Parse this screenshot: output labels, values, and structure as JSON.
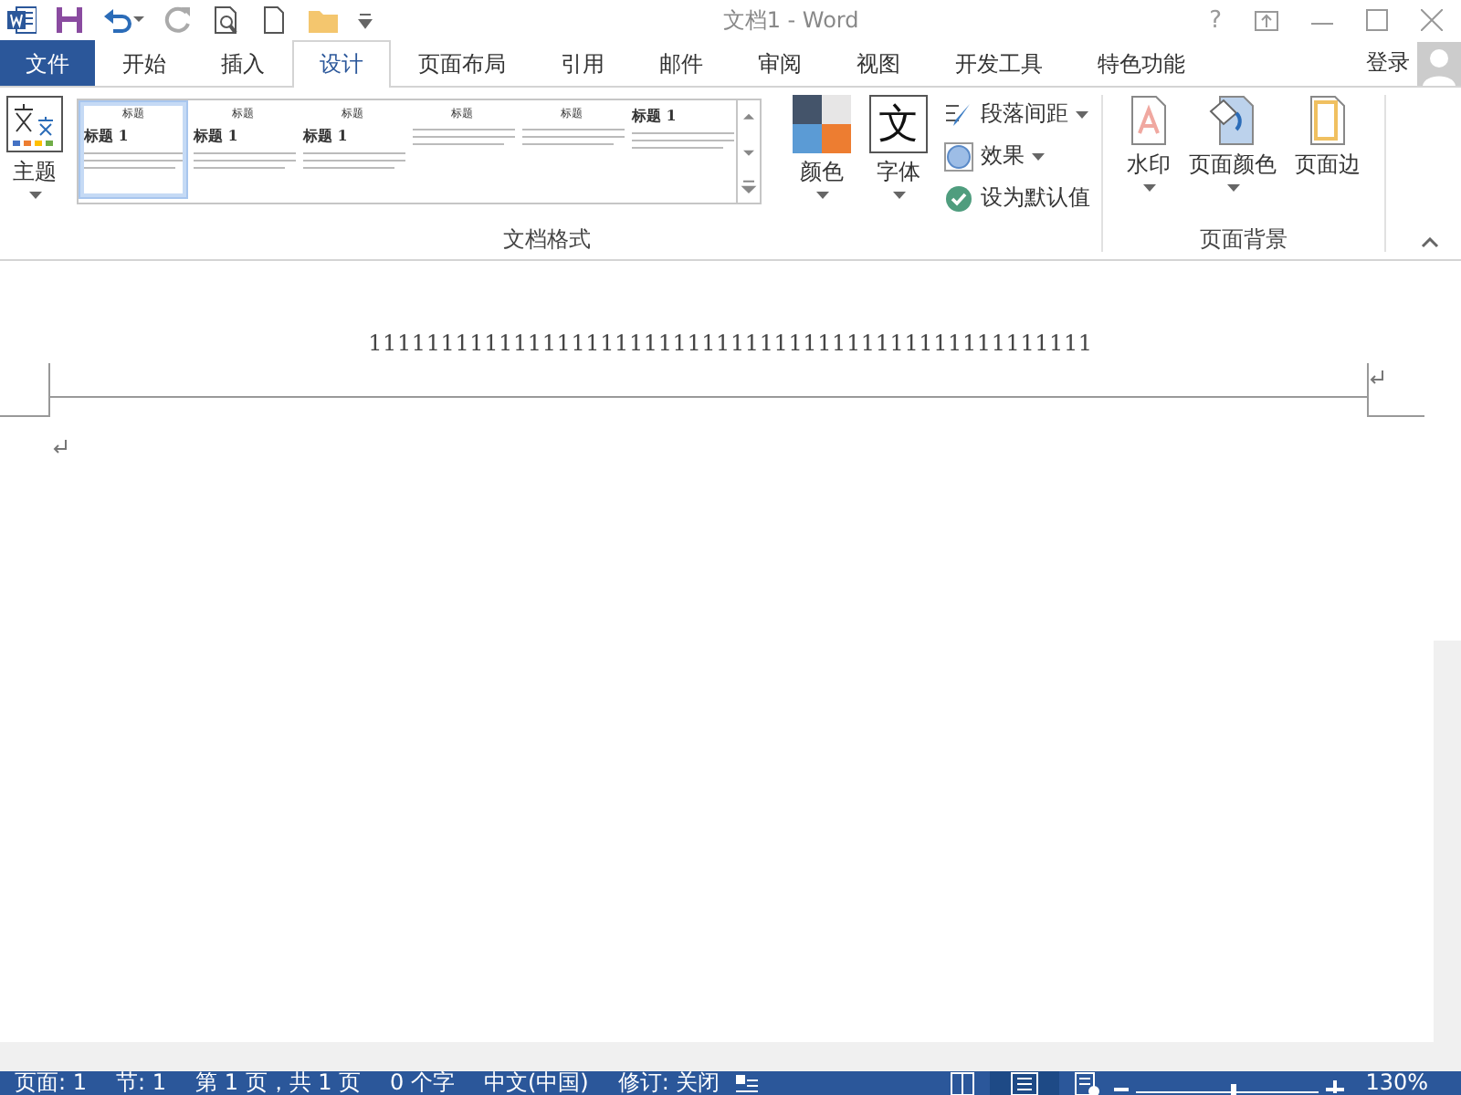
{
  "window": {
    "title": "文档1 - Word",
    "help": "?"
  },
  "tabs": [
    {
      "label": "文件",
      "kind": "file",
      "selected": false
    },
    {
      "label": "开始",
      "kind": "tab",
      "selected": false
    },
    {
      "label": "插入",
      "kind": "tab",
      "selected": false
    },
    {
      "label": "设计",
      "kind": "tab",
      "selected": true
    },
    {
      "label": "页面布局",
      "kind": "tab",
      "selected": false
    },
    {
      "label": "引用",
      "kind": "tab",
      "selected": false
    },
    {
      "label": "邮件",
      "kind": "tab",
      "selected": false
    },
    {
      "label": "审阅",
      "kind": "tab",
      "selected": false
    },
    {
      "label": "视图",
      "kind": "tab",
      "selected": false
    },
    {
      "label": "开发工具",
      "kind": "tab",
      "selected": false
    },
    {
      "label": "特色功能",
      "kind": "tab",
      "selected": false
    }
  ],
  "account": {
    "label": "登录"
  },
  "ribbon": {
    "theme_button": "主题",
    "gallery": [
      {
        "title": "标题",
        "heading": "标题 1",
        "selected": true
      },
      {
        "title": "标题",
        "heading": "标题 1",
        "selected": false
      },
      {
        "title": "标题",
        "heading": "标题 1",
        "selected": false
      },
      {
        "title": "标题",
        "selected": false
      },
      {
        "title": "标题",
        "selected": false
      },
      {
        "heading": "标题 1",
        "selected": false
      }
    ],
    "colors_button": "颜色",
    "fonts_icon": "文",
    "fonts_button": "字体",
    "small_buttons": [
      {
        "label": "段落间距",
        "kind": "spacing",
        "dropdown": true
      },
      {
        "label": "效果",
        "kind": "effects",
        "dropdown": true
      },
      {
        "label": "设为默认值",
        "kind": "default",
        "dropdown": false
      }
    ],
    "group_label": "文档格式",
    "background_buttons": [
      {
        "label": "水印",
        "kind": "watermark",
        "dropdown": true
      },
      {
        "label": "页面颜色",
        "kind": "pagecolor",
        "dropdown": true
      },
      {
        "label": "页面边",
        "kind": "border",
        "dropdown": false
      }
    ],
    "background_group_label": "页面背景"
  },
  "document": {
    "header_text": "11111111111111111111111111111111111111111111111111"
  },
  "status_bar": {
    "items": [
      "页面: 1",
      "节: 1",
      "第 1 页，共 1 页",
      "0 个字",
      "中文(中国)",
      "修订: 关闭"
    ],
    "level": 0.53,
    "zoom": "130%"
  }
}
